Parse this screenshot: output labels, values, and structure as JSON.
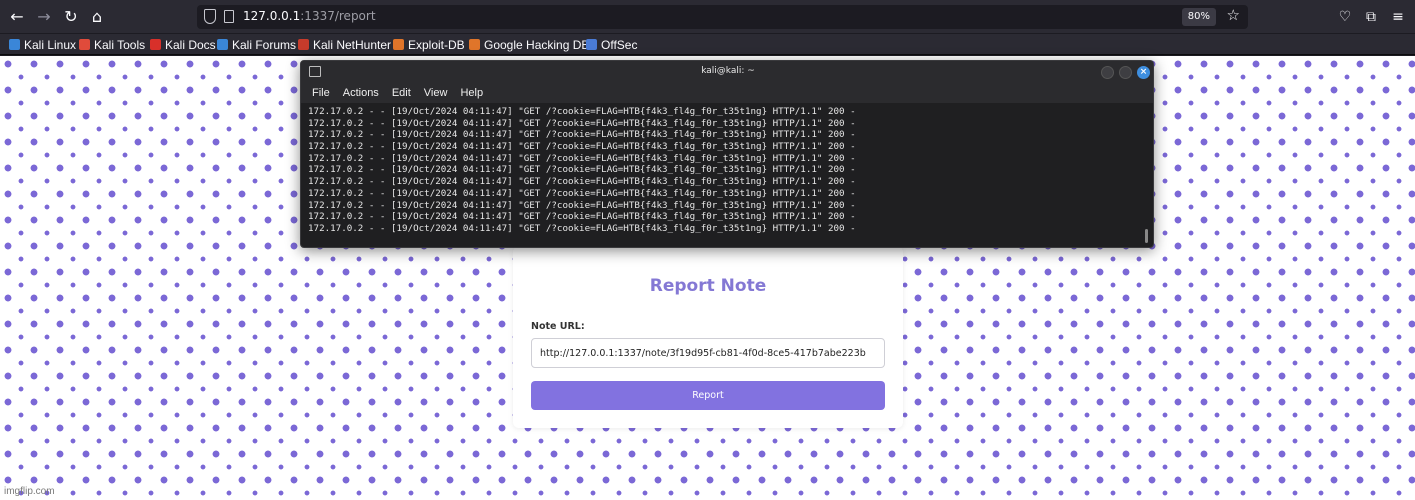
{
  "browser": {
    "url_host": "127.0.0.1",
    "url_rest": ":1337/report",
    "zoom": "80%",
    "bookmarks": [
      {
        "label": "Kali Linux",
        "color": "#3a86d8"
      },
      {
        "label": "Kali Tools",
        "color": "#e04b3b"
      },
      {
        "label": "Kali Docs",
        "color": "#d8302a"
      },
      {
        "label": "Kali Forums",
        "color": "#3a86d8"
      },
      {
        "label": "Kali NetHunter",
        "color": "#c73b2b"
      },
      {
        "label": "Exploit-DB",
        "color": "#e0752a"
      },
      {
        "label": "Google Hacking DB",
        "color": "#e0752a"
      },
      {
        "label": "OffSec",
        "color": "#4a7bd6"
      }
    ]
  },
  "terminal": {
    "title": "kali@kali: ~",
    "menu": [
      "File",
      "Actions",
      "Edit",
      "View",
      "Help"
    ],
    "lines": [
      "172.17.0.2 - - [19/Oct/2024 04:11:47] \"GET /?cookie=FLAG=HTB{f4k3_fl4g_f0r_t35t1ng} HTTP/1.1\" 200 -",
      "172.17.0.2 - - [19/Oct/2024 04:11:47] \"GET /?cookie=FLAG=HTB{f4k3_fl4g_f0r_t35t1ng} HTTP/1.1\" 200 -",
      "172.17.0.2 - - [19/Oct/2024 04:11:47] \"GET /?cookie=FLAG=HTB{f4k3_fl4g_f0r_t35t1ng} HTTP/1.1\" 200 -",
      "172.17.0.2 - - [19/Oct/2024 04:11:47] \"GET /?cookie=FLAG=HTB{f4k3_fl4g_f0r_t35t1ng} HTTP/1.1\" 200 -",
      "172.17.0.2 - - [19/Oct/2024 04:11:47] \"GET /?cookie=FLAG=HTB{f4k3_fl4g_f0r_t35t1ng} HTTP/1.1\" 200 -",
      "172.17.0.2 - - [19/Oct/2024 04:11:47] \"GET /?cookie=FLAG=HTB{f4k3_fl4g_f0r_t35t1ng} HTTP/1.1\" 200 -",
      "172.17.0.2 - - [19/Oct/2024 04:11:47] \"GET /?cookie=FLAG=HTB{f4k3_fl4g_f0r_t35t1ng} HTTP/1.1\" 200 -",
      "172.17.0.2 - - [19/Oct/2024 04:11:47] \"GET /?cookie=FLAG=HTB{f4k3_fl4g_f0r_t35t1ng} HTTP/1.1\" 200 -",
      "172.17.0.2 - - [19/Oct/2024 04:11:47] \"GET /?cookie=FLAG=HTB{f4k3_fl4g_f0r_t35t1ng} HTTP/1.1\" 200 -",
      "172.17.0.2 - - [19/Oct/2024 04:11:47] \"GET /?cookie=FLAG=HTB{f4k3_fl4g_f0r_t35t1ng} HTTP/1.1\" 200 -",
      "172.17.0.2 - - [19/Oct/2024 04:11:47] \"GET /?cookie=FLAG=HTB{f4k3_fl4g_f0r_t35t1ng} HTTP/1.1\" 200 -"
    ]
  },
  "report": {
    "title": "Report Note",
    "field_label": "Note URL:",
    "url_value": "http://127.0.0.1:1337/note/3f19d95f-cb81-4f0d-8ce5-417b7abe223b",
    "button_label": "Report"
  },
  "watermark": "imgflip.com",
  "colors": {
    "accent": "#8272e0",
    "pattern": "#7b68d6",
    "title": "#8478d4"
  }
}
